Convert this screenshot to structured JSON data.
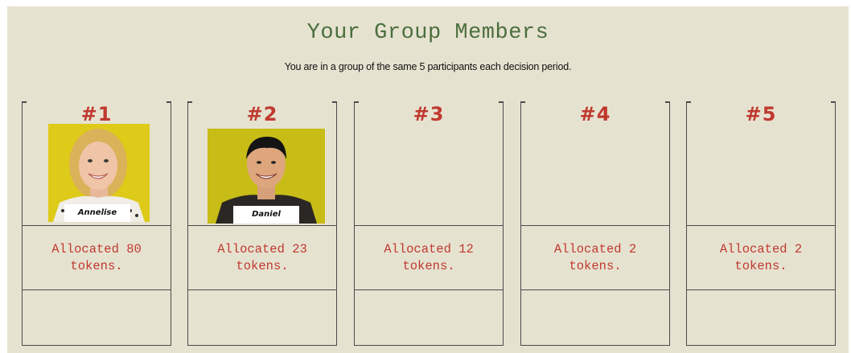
{
  "header": {
    "title": "Your Group Members",
    "subtitle": "You are in a group of the same 5 participants each decision period."
  },
  "colors": {
    "background": "#e6e2d0",
    "title": "#4a6f3e",
    "accent_red": "#c0392f",
    "photo_backdrop": "#e0d21f"
  },
  "members": [
    {
      "number": "#1",
      "name": "Annelise",
      "has_photo": true,
      "allocation_line1": "Allocated 80",
      "allocation_line2": "tokens.",
      "tokens": 80
    },
    {
      "number": "#2",
      "name": "Daniel",
      "has_photo": true,
      "allocation_line1": "Allocated 23",
      "allocation_line2": "tokens.",
      "tokens": 23
    },
    {
      "number": "#3",
      "name": "",
      "has_photo": false,
      "allocation_line1": "Allocated 12",
      "allocation_line2": "tokens.",
      "tokens": 12
    },
    {
      "number": "#4",
      "name": "",
      "has_photo": false,
      "allocation_line1": "Allocated 2",
      "allocation_line2": "tokens.",
      "tokens": 2
    },
    {
      "number": "#5",
      "name": "",
      "has_photo": false,
      "allocation_line1": "Allocated 2",
      "allocation_line2": "tokens.",
      "tokens": 2
    }
  ]
}
